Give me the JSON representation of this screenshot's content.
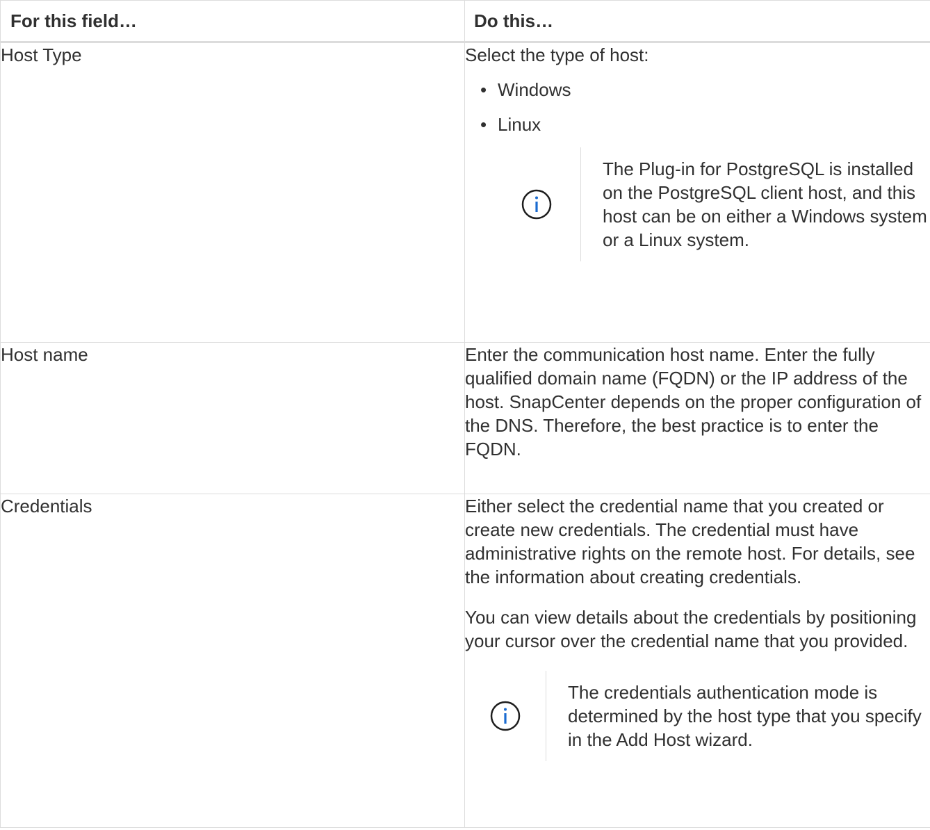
{
  "table": {
    "headers": [
      "For this field…",
      "Do this…"
    ],
    "rows": [
      {
        "field": "Host Type",
        "intro": "Select the type of host:",
        "options": [
          "Windows",
          "Linux"
        ],
        "note": "The Plug-in for PostgreSQL is installed on the PostgreSQL client host, and this host can be on either a Windows system or a Linux system."
      },
      {
        "field": "Host name",
        "text": "Enter the communication host name. Enter the fully qualified domain name (FQDN) or the IP address of the host. SnapCenter depends on the proper configuration of the DNS. Therefore, the best practice is to enter the FQDN."
      },
      {
        "field": "Credentials",
        "text": "Either select the credential name that you created or create new credentials. The credential must have administrative rights on the remote host. For details, see the information about creating credentials.",
        "text2": "You can view details about the credentials by positioning your cursor over the credential name that you provided.",
        "note": "The credentials authentication mode is determined by the host type that you specify in the Add Host wizard."
      }
    ]
  },
  "icons": {
    "note_icon": "info-circle-icon",
    "note_icon_color": "#1a6bd0"
  }
}
